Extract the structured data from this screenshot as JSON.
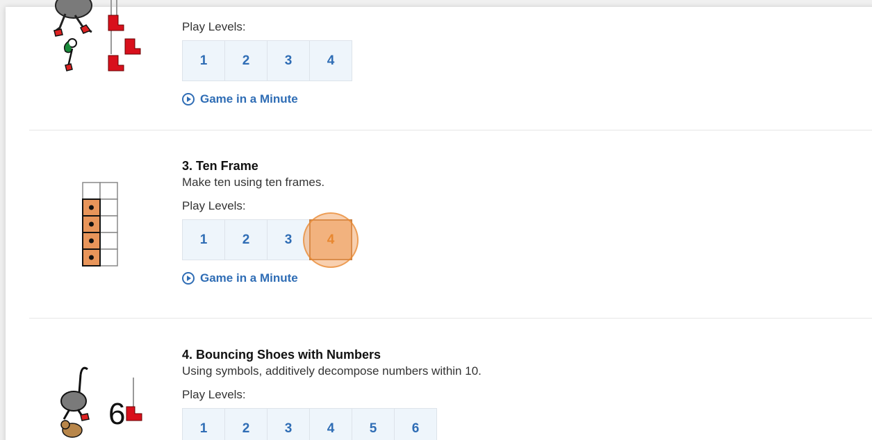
{
  "games": [
    {
      "title": "",
      "description": "",
      "play_levels_label": "Play Levels:",
      "levels": [
        "1",
        "2",
        "3",
        "4"
      ],
      "game_in_a_minute": "Game in a Minute",
      "icon": "bouncing-shoes-icon"
    },
    {
      "title": "3. Ten Frame",
      "description": "Make ten using ten frames.",
      "play_levels_label": "Play Levels:",
      "levels": [
        "1",
        "2",
        "3",
        "4"
      ],
      "selected_level": "4",
      "game_in_a_minute": "Game in a Minute",
      "icon": "ten-frame-icon"
    },
    {
      "title": "4. Bouncing Shoes with Numbers",
      "description": "Using symbols, additively decompose numbers within 10.",
      "play_levels_label": "Play Levels:",
      "levels": [
        "1",
        "2",
        "3",
        "4",
        "5",
        "6"
      ],
      "icon": "bouncing-shoes-numbers-icon",
      "icon_number": "6"
    }
  ],
  "colors": {
    "link_blue": "#2f6db5",
    "level_bg": "#eef5fb",
    "selected_orange": "#e8872f",
    "ten_frame_fill": "#e8955a"
  }
}
